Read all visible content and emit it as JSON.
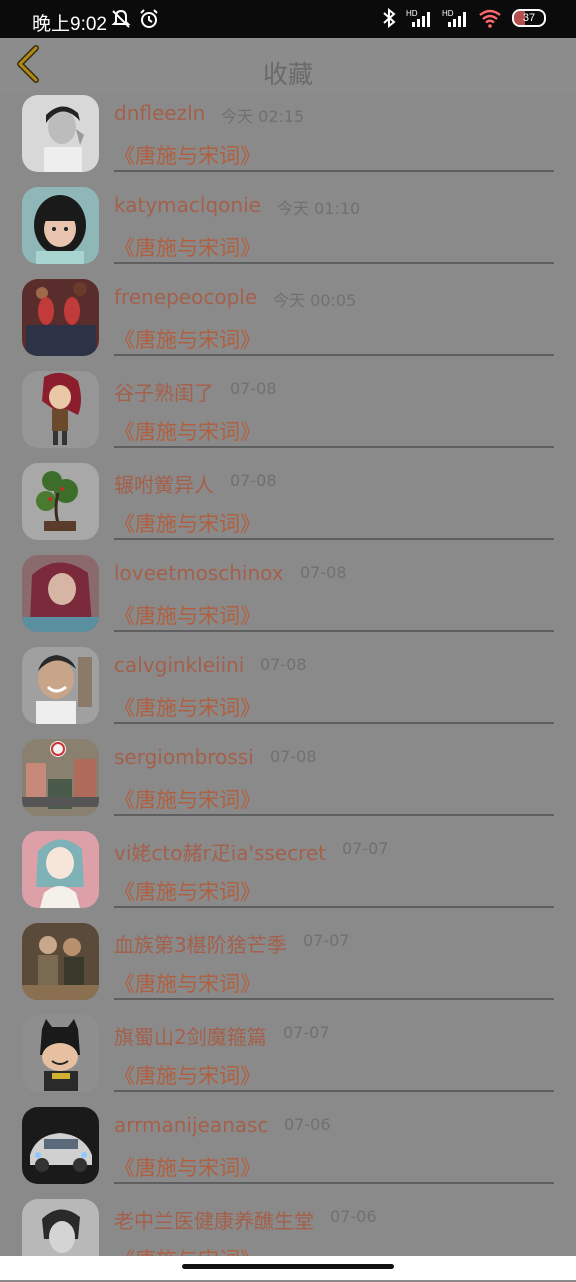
{
  "status_bar": {
    "time": "晚上9:02",
    "hd1": "HD",
    "hd2": "HD",
    "battery": "37",
    "battery_color": "#ff6b6b"
  },
  "header": {
    "title": "收藏",
    "back_icon": "chevron-left-icon"
  },
  "list": [
    {
      "name": "dnfleezln",
      "time": "今天 02:15",
      "book": "《唐施与宋词》",
      "avatar": "avatar-man-bw"
    },
    {
      "name": "katymaclqonie",
      "time": "今天 01:10",
      "book": "《唐施与宋词》",
      "avatar": "avatar-girl"
    },
    {
      "name": "frenepeocople",
      "time": "今天 00:05",
      "book": "《唐施与宋词》",
      "avatar": "avatar-shoes"
    },
    {
      "name": "谷子熟闺了",
      "time": "07-08",
      "book": "《唐施与宋词》",
      "avatar": "avatar-anime-red"
    },
    {
      "name": "辗咐黉异人",
      "time": "07-08",
      "book": "《唐施与宋词》",
      "avatar": "avatar-bonsai"
    },
    {
      "name": "loveetmoschinox",
      "time": "07-08",
      "book": "《唐施与宋词》",
      "avatar": "avatar-woman-red-hair"
    },
    {
      "name": "calvginkleiini",
      "time": "07-08",
      "book": "《唐施与宋词》",
      "avatar": "avatar-boy-smile"
    },
    {
      "name": "sergiombrossi",
      "time": "07-08",
      "book": "《唐施与宋词》",
      "avatar": "avatar-street"
    },
    {
      "name": "vi姥cto赭r疋ia'ssecret",
      "time": "07-07",
      "book": "《唐施与宋词》",
      "avatar": "avatar-cartoon-girl"
    },
    {
      "name": "血族第3椹阶猞芒季",
      "time": "07-07",
      "book": "《唐施与宋词》",
      "avatar": "avatar-couple"
    },
    {
      "name": "旗蜀山2剑魔箍篇",
      "time": "07-07",
      "book": "《唐施与宋词》",
      "avatar": "avatar-batman"
    },
    {
      "name": "arrmanijeanasc",
      "time": "07-06",
      "book": "《唐施与宋词》",
      "avatar": "avatar-car"
    },
    {
      "name": "老中兰医健康养醮生堂",
      "time": "07-06",
      "book": "《唐施与宋词》",
      "avatar": "avatar-sketch"
    }
  ]
}
